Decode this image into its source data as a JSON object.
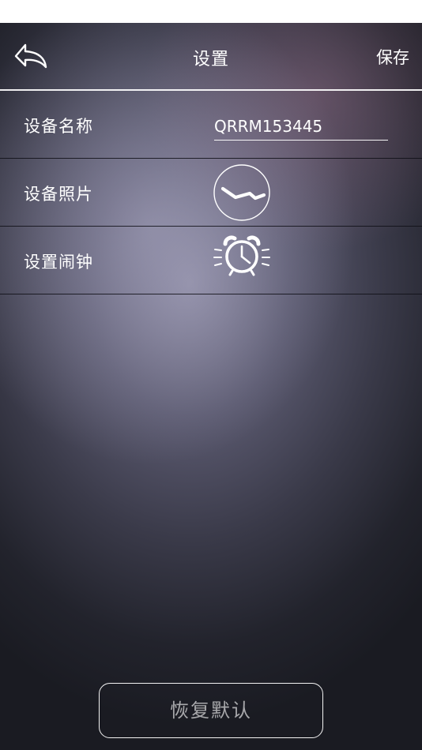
{
  "nav": {
    "title": "设置",
    "save_label": "保存",
    "back_icon": "back-arrow-icon"
  },
  "rows": [
    {
      "label": "设备名称",
      "value": "QRRM153445"
    },
    {
      "label": "设备照片",
      "icon": "device-photo-icon"
    },
    {
      "label": "设置闹钟",
      "icon": "alarm-clock-icon"
    }
  ],
  "footer": {
    "reset_label": "恢复默认"
  },
  "colors": {
    "text": "#ffffff",
    "status_bar": "#ffffff",
    "background_dark": "#1c1d26"
  }
}
